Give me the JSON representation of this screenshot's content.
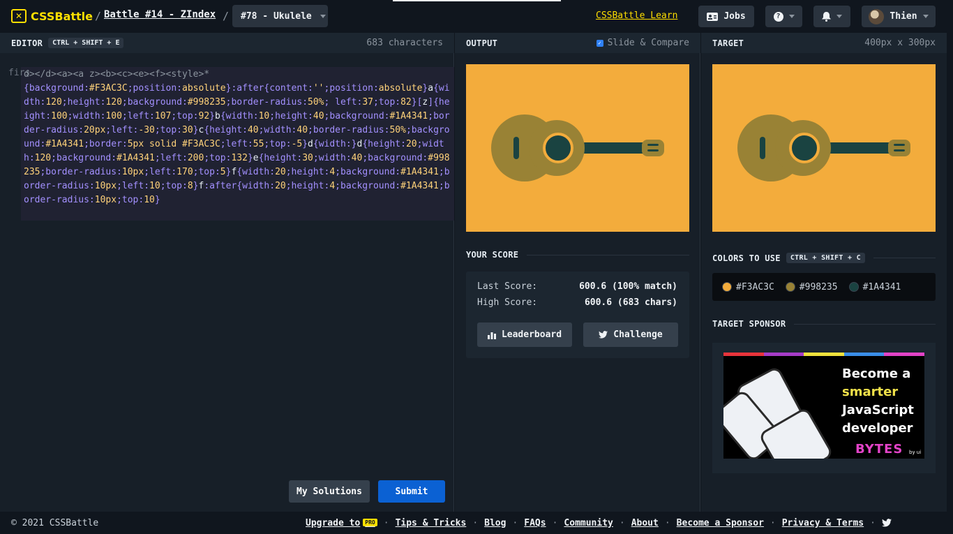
{
  "header": {
    "logo_text": "CSSBattle",
    "battle_link": "Battle #14 - ZIndex",
    "target_select": "#78 - Ukulele",
    "learn_link": "CSSBattle Learn",
    "jobs_label": "Jobs",
    "help_label": "?",
    "user_name": "Thien"
  },
  "editor": {
    "title": "EDITOR",
    "shortcut": "CTRL + SHIFT + E",
    "char_count": "683 characters",
    "ghost_prefix": "firs"
  },
  "output": {
    "title": "OUTPUT",
    "slide_compare": "Slide & Compare"
  },
  "target": {
    "title": "TARGET",
    "size": "400px x 300px"
  },
  "score": {
    "title": "YOUR SCORE",
    "last_label": "Last Score:",
    "last_value": "600.6 (100% match)",
    "high_label": "High Score:",
    "high_value": "600.6 (683 chars)",
    "leaderboard_label": "Leaderboard",
    "challenge_label": "Challenge"
  },
  "colors": {
    "title": "COLORS TO USE",
    "shortcut": "CTRL + SHIFT + C",
    "swatches": [
      {
        "hex": "#F3AC3C",
        "label": "#F3AC3C"
      },
      {
        "hex": "#998235",
        "label": "#998235"
      },
      {
        "hex": "#1A4341",
        "label": "#1A4341"
      }
    ]
  },
  "sponsor": {
    "title": "TARGET SPONSOR",
    "ad_line1": "Become a",
    "ad_line2": "smarter",
    "ad_line3": "JavaScript",
    "ad_line4": "developer",
    "ad_brand": "BYTES",
    "ad_by": "by ui",
    "stripe_colors": [
      "#e8343b",
      "#a63cc8",
      "#f1e23d",
      "#3a8ee8",
      "#e243c7"
    ]
  },
  "actions": {
    "my_solutions": "My Solutions",
    "submit": "Submit"
  },
  "footer": {
    "copyright": "© 2021 CSSBattle",
    "upgrade": "Upgrade to",
    "pro_badge": "PRO",
    "tips": "Tips & Tricks",
    "blog": "Blog",
    "faqs": "FAQs",
    "community": "Community",
    "about": "About",
    "sponsor": "Become a Sponsor",
    "privacy": "Privacy & Terms"
  },
  "palette": {
    "orange": "#F3AC3C",
    "olive": "#998235",
    "dark": "#1A4341",
    "accent_yellow": "#ffdf00",
    "submit_blue": "#0b61d3"
  }
}
